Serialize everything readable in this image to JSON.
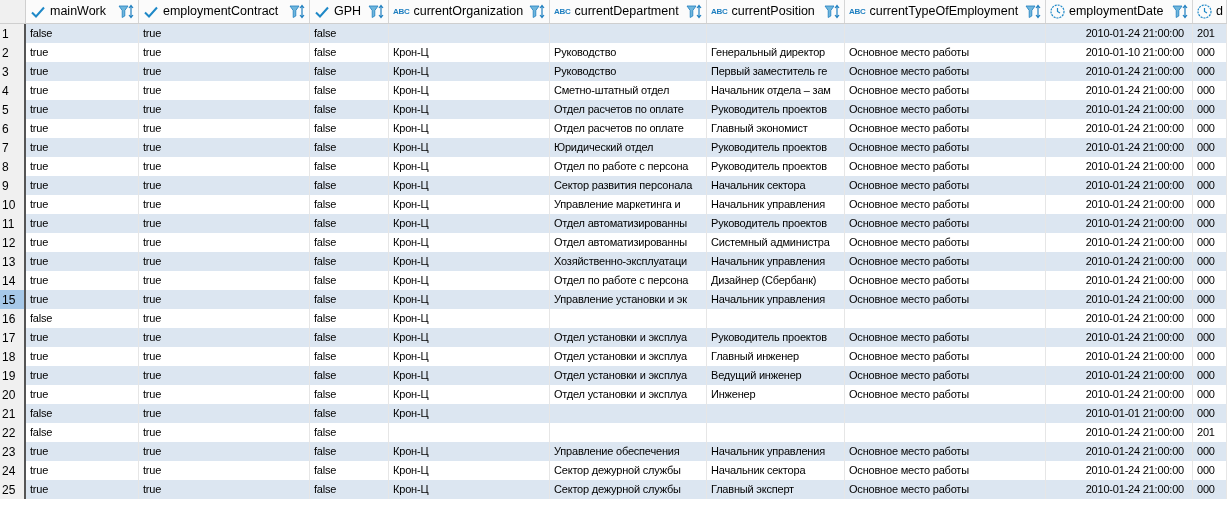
{
  "table": {
    "columns": [
      {
        "name": "mainWork",
        "kind": "boolean"
      },
      {
        "name": "employmentContract",
        "kind": "boolean"
      },
      {
        "name": "GPH",
        "kind": "boolean"
      },
      {
        "name": "currentOrganization",
        "kind": "string",
        "badge": "ABC"
      },
      {
        "name": "currentDepartment",
        "kind": "string",
        "badge": "ABC"
      },
      {
        "name": "currentPosition",
        "kind": "string",
        "badge": "ABC"
      },
      {
        "name": "currentTypeOfEmployment",
        "kind": "string",
        "badge": "ABC"
      },
      {
        "name": "employmentDate",
        "kind": "datetime"
      },
      {
        "name": "d",
        "kind": "datetime"
      }
    ],
    "rows": [
      {
        "number": "1",
        "selected": false,
        "cells": [
          "false",
          "true",
          "false",
          null,
          null,
          null,
          null,
          "2010-01-24 21:00:00",
          "201"
        ]
      },
      {
        "number": "2",
        "selected": false,
        "cells": [
          "true",
          "true",
          "false",
          "Крон-Ц",
          "Руководство",
          "Генеральный директор",
          "Основное место работы",
          "2010-01-10 21:00:00",
          "000"
        ]
      },
      {
        "number": "3",
        "selected": false,
        "cells": [
          "true",
          "true",
          "false",
          "Крон-Ц",
          "Руководство",
          "Первый заместитель ге",
          "Основное место работы",
          "2010-01-24 21:00:00",
          "000"
        ]
      },
      {
        "number": "4",
        "selected": false,
        "cells": [
          "true",
          "true",
          "false",
          "Крон-Ц",
          "Сметно-штатный отдел",
          "Начальник отдела – зам",
          "Основное место работы",
          "2010-01-24 21:00:00",
          "000"
        ]
      },
      {
        "number": "5",
        "selected": false,
        "cells": [
          "true",
          "true",
          "false",
          "Крон-Ц",
          "Отдел расчетов по оплате",
          "Руководитель проектов",
          "Основное место работы",
          "2010-01-24 21:00:00",
          "000"
        ]
      },
      {
        "number": "6",
        "selected": false,
        "cells": [
          "true",
          "true",
          "false",
          "Крон-Ц",
          "Отдел расчетов по оплате",
          "Главный экономист",
          "Основное место работы",
          "2010-01-24 21:00:00",
          "000"
        ]
      },
      {
        "number": "7",
        "selected": false,
        "cells": [
          "true",
          "true",
          "false",
          "Крон-Ц",
          "Юридический отдел",
          "Руководитель проектов",
          "Основное место работы",
          "2010-01-24 21:00:00",
          "000"
        ]
      },
      {
        "number": "8",
        "selected": false,
        "cells": [
          "true",
          "true",
          "false",
          "Крон-Ц",
          "Отдел по работе с персона",
          "Руководитель проектов",
          "Основное место работы",
          "2010-01-24 21:00:00",
          "000"
        ]
      },
      {
        "number": "9",
        "selected": false,
        "cells": [
          "true",
          "true",
          "false",
          "Крон-Ц",
          "Сектор развития персонала",
          "Начальник сектора",
          "Основное место работы",
          "2010-01-24 21:00:00",
          "000"
        ]
      },
      {
        "number": "10",
        "selected": false,
        "cells": [
          "true",
          "true",
          "false",
          "Крон-Ц",
          "Управление маркетинга и",
          "Начальник управления",
          "Основное место работы",
          "2010-01-24 21:00:00",
          "000"
        ]
      },
      {
        "number": "11",
        "selected": false,
        "cells": [
          "true",
          "true",
          "false",
          "Крон-Ц",
          "Отдел автоматизированны",
          "Руководитель проектов",
          "Основное место работы",
          "2010-01-24 21:00:00",
          "000"
        ]
      },
      {
        "number": "12",
        "selected": false,
        "cells": [
          "true",
          "true",
          "false",
          "Крон-Ц",
          "Отдел автоматизированны",
          "Системный администра",
          "Основное место работы",
          "2010-01-24 21:00:00",
          "000"
        ]
      },
      {
        "number": "13",
        "selected": false,
        "cells": [
          "true",
          "true",
          "false",
          "Крон-Ц",
          "Хозяйственно-эксплуатаци",
          "Начальник управления",
          "Основное место работы",
          "2010-01-24 21:00:00",
          "000"
        ]
      },
      {
        "number": "14",
        "selected": false,
        "cells": [
          "true",
          "true",
          "false",
          "Крон-Ц",
          "Отдел по работе с персона",
          "Дизайнер (Сбербанк)",
          "Основное место работы",
          "2010-01-24 21:00:00",
          "000"
        ]
      },
      {
        "number": "15",
        "selected": true,
        "cells": [
          "true",
          "true",
          "false",
          "Крон-Ц",
          "Управление установки и эк",
          "Начальник управления",
          "Основное место работы",
          "2010-01-24 21:00:00",
          "000"
        ]
      },
      {
        "number": "16",
        "selected": false,
        "cells": [
          "false",
          "true",
          "false",
          "Крон-Ц",
          null,
          null,
          null,
          "2010-01-24 21:00:00",
          "000"
        ]
      },
      {
        "number": "17",
        "selected": false,
        "cells": [
          "true",
          "true",
          "false",
          "Крон-Ц",
          "Отдел установки и эксплуа",
          "Руководитель проектов",
          "Основное место работы",
          "2010-01-24 21:00:00",
          "000"
        ]
      },
      {
        "number": "18",
        "selected": false,
        "cells": [
          "true",
          "true",
          "false",
          "Крон-Ц",
          "Отдел установки и эксплуа",
          "Главный инженер",
          "Основное место работы",
          "2010-01-24 21:00:00",
          "000"
        ]
      },
      {
        "number": "19",
        "selected": false,
        "cells": [
          "true",
          "true",
          "false",
          "Крон-Ц",
          "Отдел установки и эксплуа",
          "Ведущий инженер",
          "Основное место работы",
          "2010-01-24 21:00:00",
          "000"
        ]
      },
      {
        "number": "20",
        "selected": false,
        "cells": [
          "true",
          "true",
          "false",
          "Крон-Ц",
          "Отдел установки и эксплуа",
          "Инженер",
          "Основное место работы",
          "2010-01-24 21:00:00",
          "000"
        ]
      },
      {
        "number": "21",
        "selected": false,
        "cells": [
          "false",
          "true",
          "false",
          "Крон-Ц",
          null,
          null,
          null,
          "2010-01-01 21:00:00",
          "000"
        ]
      },
      {
        "number": "22",
        "selected": false,
        "cells": [
          "false",
          "true",
          "false",
          null,
          null,
          null,
          null,
          "2010-01-24 21:00:00",
          "201"
        ]
      },
      {
        "number": "23",
        "selected": false,
        "cells": [
          "true",
          "true",
          "false",
          "Крон-Ц",
          "Управление обеспечения",
          "Начальник управления",
          "Основное место работы",
          "2010-01-24 21:00:00",
          "000"
        ]
      },
      {
        "number": "24",
        "selected": false,
        "cells": [
          "true",
          "true",
          "false",
          "Крон-Ц",
          "Сектор дежурной службы",
          "Начальник сектора",
          "Основное место работы",
          "2010-01-24 21:00:00",
          "000"
        ]
      },
      {
        "number": "25",
        "selected": false,
        "cells": [
          "true",
          "true",
          "false",
          "Крон-Ц",
          "Сектор дежурной службы",
          "Главный эксперт",
          "Основное место работы",
          "2010-01-24 21:00:00",
          "000"
        ]
      }
    ]
  }
}
